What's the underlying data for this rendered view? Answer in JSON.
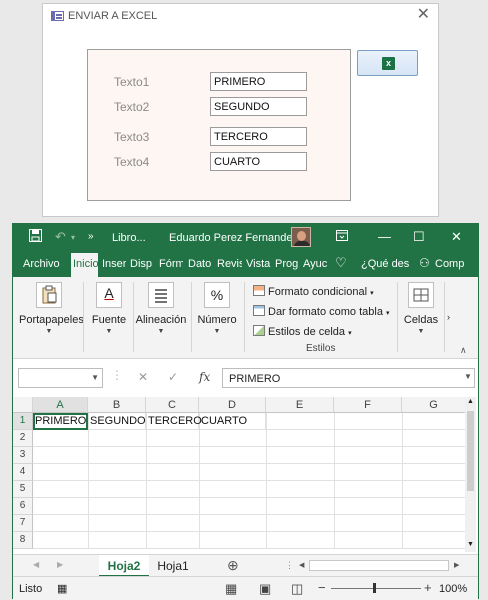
{
  "access_form": {
    "title": "ENVIAR A EXCEL",
    "close_glyph": "✕",
    "fields": [
      {
        "label": "Texto1",
        "value": "PRIMERO"
      },
      {
        "label": "Texto2",
        "value": "SEGUNDO"
      },
      {
        "label": "Texto3",
        "value": "TERCERO"
      },
      {
        "label": "Texto4",
        "value": "CUARTO"
      }
    ],
    "export_button_icon": "excel-icon",
    "export_button_glyph": "x"
  },
  "excel": {
    "title": "Libro...",
    "user": "Eduardo Perez Fernandez",
    "tabs": [
      "Archivo",
      "Inicio",
      "Inser",
      "Disp",
      "Fórm",
      "Dato",
      "Revis",
      "Vista",
      "Prog",
      "Ayuc",
      "¿Qué des",
      "Comp"
    ],
    "active_tab": "Inicio",
    "ribbon": {
      "groups": [
        "Portapapeles",
        "Fuente",
        "Alineación",
        "Número",
        "Celdas"
      ],
      "styles": [
        "Formato condicional",
        "Dar formato como tabla",
        "Estilos de celda"
      ],
      "styles_group": "Estilos",
      "number_symbol": "%",
      "font_symbol": "A"
    },
    "formula_bar": {
      "fx": "fx",
      "value": "PRIMERO"
    },
    "columns": [
      "A",
      "B",
      "C",
      "D",
      "E",
      "F",
      "G"
    ],
    "rows": [
      "1",
      "2",
      "3",
      "4",
      "5",
      "6",
      "7",
      "8"
    ],
    "cells": {
      "A1": "PRIMERO",
      "B1": "SEGUNDO",
      "C1": "TERCERO",
      "D1": "CUARTO"
    },
    "sheets": [
      "Hoja2",
      "Hoja1"
    ],
    "active_sheet": "Hoja2",
    "status": "Listo",
    "zoom": "100%",
    "colors": {
      "accent": "#217346"
    }
  }
}
